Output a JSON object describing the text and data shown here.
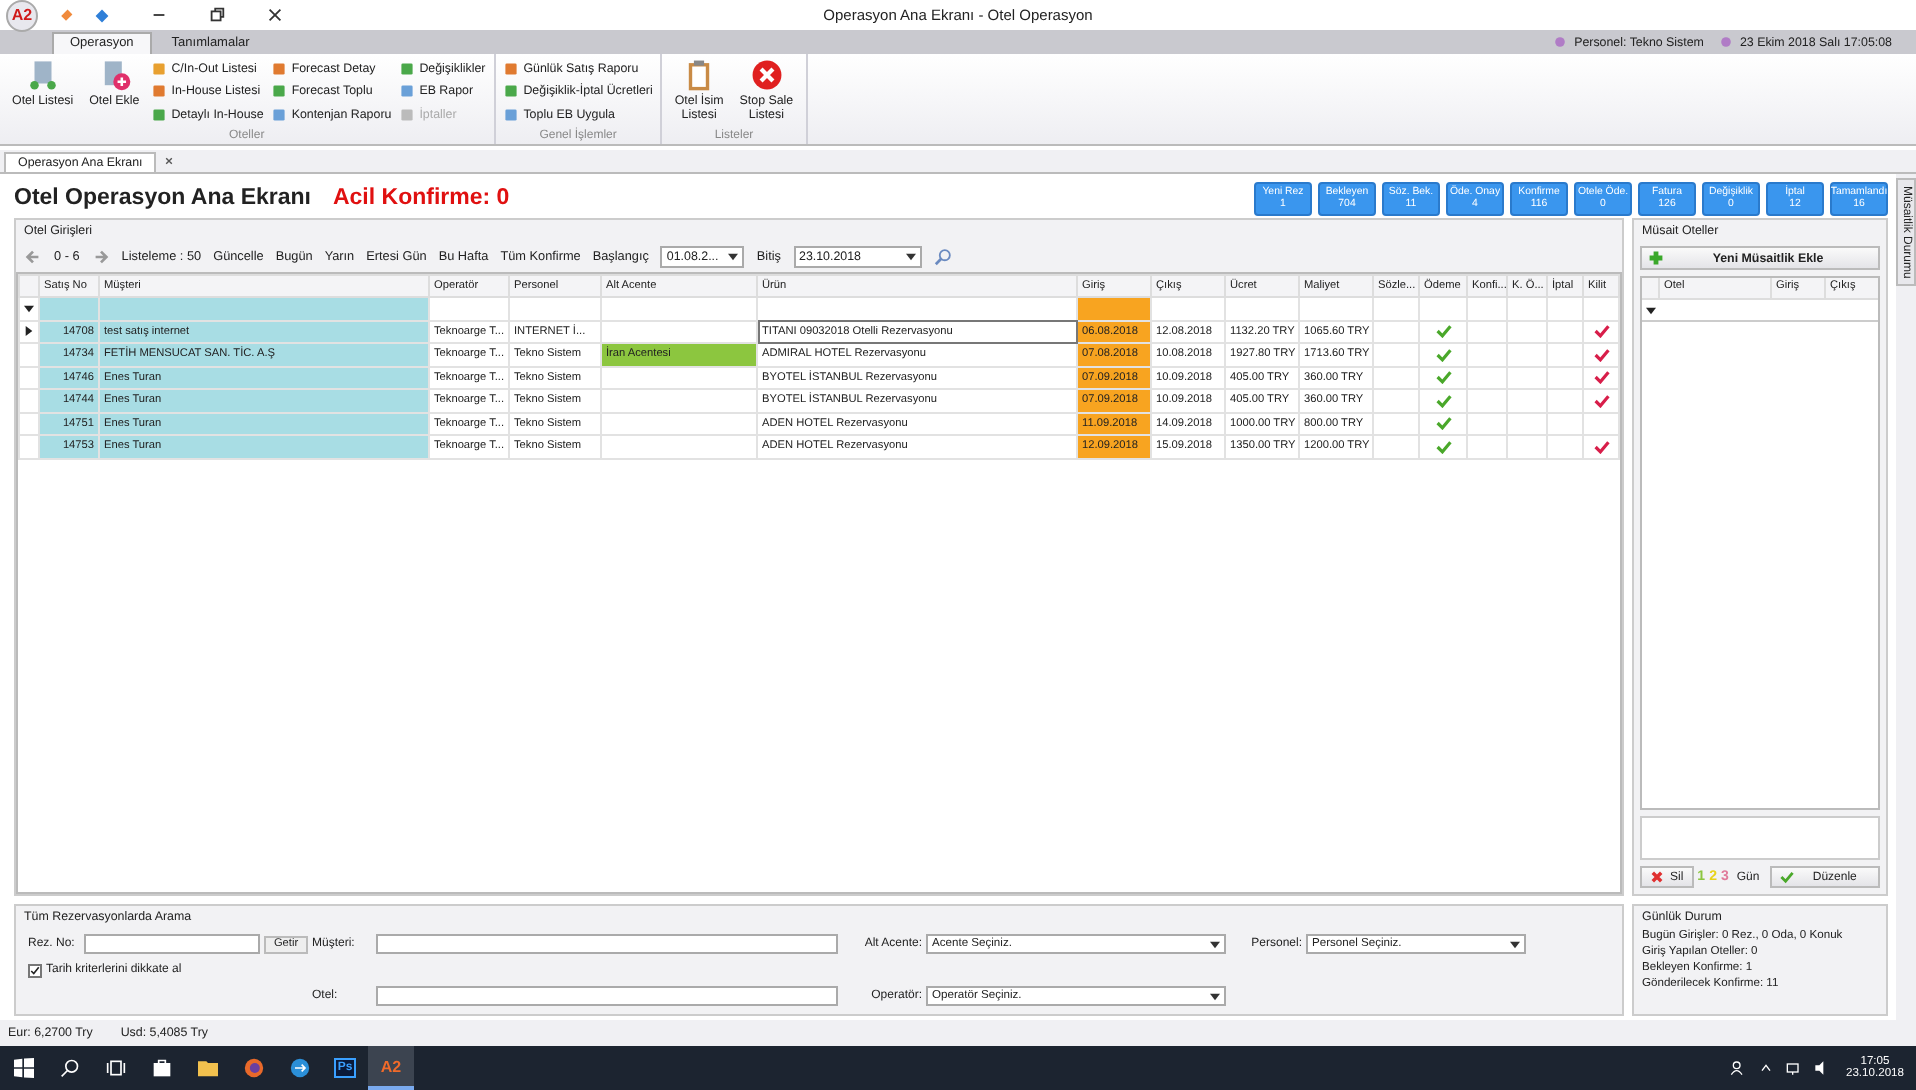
{
  "window": {
    "logo": "A2",
    "title": "Operasyon Ana Ekranı - Otel Operasyon"
  },
  "ribbon": {
    "tabs": [
      {
        "label": "Operasyon",
        "selected": true
      },
      {
        "label": "Tanımlamalar",
        "selected": false
      }
    ],
    "user": "Personel: Tekno Sistem",
    "datetime": "23 Ekim 2018 Salı 17:05:08",
    "groups": [
      {
        "label": "Oteller",
        "large": [
          {
            "kind": "hotel_list",
            "label": "Otel Listesi"
          },
          {
            "kind": "hotel_add",
            "label": "Otel Ekle"
          }
        ],
        "columns": [
          [
            {
              "label": "C/In-Out Listesi",
              "disabled": false
            },
            {
              "label": "In-House Listesi",
              "disabled": false
            },
            {
              "label": "Detaylı In-House",
              "disabled": false
            }
          ],
          [
            {
              "label": "Forecast Detay",
              "disabled": false
            },
            {
              "label": "Forecast Toplu",
              "disabled": false
            },
            {
              "label": "Kontenjan Raporu",
              "disabled": false
            }
          ],
          [
            {
              "label": "Değişiklikler",
              "disabled": false
            },
            {
              "label": "EB Rapor",
              "disabled": false
            },
            {
              "label": "İptaller",
              "disabled": true
            }
          ]
        ]
      },
      {
        "label": "Genel İşlemler",
        "columns": [
          [
            {
              "label": "Günlük Satış Raporu",
              "disabled": false
            },
            {
              "label": "Değişiklik-İptal Ücretleri",
              "disabled": false
            },
            {
              "label": "Toplu EB Uygula",
              "disabled": false
            }
          ]
        ]
      },
      {
        "label": "Listeler",
        "large": [
          {
            "kind": "clipboard",
            "label": "Otel İsim\nListesi"
          },
          {
            "kind": "stop",
            "label": "Stop Sale\nListesi"
          }
        ]
      }
    ]
  },
  "doc_tab": "Operasyon Ana Ekranı",
  "header": {
    "title": "Otel Operasyon Ana Ekranı",
    "alert": "Acil Konfirme: 0",
    "badges": [
      {
        "label": "Yeni Rez",
        "count": "1"
      },
      {
        "label": "Bekleyen",
        "count": "704"
      },
      {
        "label": "Söz. Bek.",
        "count": "11"
      },
      {
        "label": "Öde. Onay",
        "count": "4"
      },
      {
        "label": "Konfirme",
        "count": "116"
      },
      {
        "label": "Otele Öde.",
        "count": "0"
      },
      {
        "label": "Fatura",
        "count": "126"
      },
      {
        "label": "Değişiklik",
        "count": "0"
      },
      {
        "label": "İptal",
        "count": "12"
      },
      {
        "label": "Tamamlandı",
        "count": "16"
      }
    ]
  },
  "side_tab": "Müsaitlik Durumu",
  "entries": {
    "title": "Otel Girişleri",
    "pager": "0 - 6",
    "page_size": "Listeleme : 50",
    "buttons": [
      "Güncelle",
      "Bugün",
      "Yarın",
      "Ertesi Gün",
      "Bu Hafta",
      "Tüm Konfirme"
    ],
    "start_label": "Başlangıç",
    "start_value": "01.08.2...",
    "end_label": "Bitiş",
    "end_value": "23.10.2018",
    "columns": [
      "Satış No",
      "Müşteri",
      "Operatör",
      "Personel",
      "Alt Acente",
      "Ürün",
      "Giriş",
      "Çıkış",
      "Ücret",
      "Maliyet",
      "Sözle...",
      "Ödeme",
      "Konfi...",
      "K. Ö...",
      "İptal",
      "Kilit"
    ],
    "rows": [
      {
        "selected": true,
        "no": "14708",
        "customer": "test satış internet",
        "operator": "Teknoarge T...",
        "staff": "INTERNET İ...",
        "agency": "",
        "product": "TITANI 09032018 Otelli Rezervasyonu",
        "checkin": "06.08.2018",
        "checkout": "12.08.2018",
        "price": "1132.20 TRY",
        "cost": "1065.60 TRY",
        "paid": true,
        "locked": true
      },
      {
        "selected": false,
        "no": "14734",
        "customer": "FETİH MENSUCAT SAN. TİC. A.Ş",
        "operator": "Teknoarge T...",
        "staff": "Tekno Sistem",
        "agency": "İran Acentesi",
        "product": "ADMIRAL HOTEL Rezervasyonu",
        "checkin": "07.08.2018",
        "checkout": "10.08.2018",
        "price": "1927.80 TRY",
        "cost": "1713.60 TRY",
        "paid": true,
        "locked": true
      },
      {
        "selected": false,
        "no": "14746",
        "customer": "Enes Turan",
        "operator": "Teknoarge T...",
        "staff": "Tekno Sistem",
        "agency": "",
        "product": "BYOTEL İSTANBUL Rezervasyonu",
        "checkin": "07.09.2018",
        "checkout": "10.09.2018",
        "price": "405.00 TRY",
        "cost": "360.00 TRY",
        "paid": true,
        "locked": true
      },
      {
        "selected": false,
        "no": "14744",
        "customer": "Enes Turan",
        "operator": "Teknoarge T...",
        "staff": "Tekno Sistem",
        "agency": "",
        "product": "BYOTEL İSTANBUL Rezervasyonu",
        "checkin": "07.09.2018",
        "checkout": "10.09.2018",
        "price": "405.00 TRY",
        "cost": "360.00 TRY",
        "paid": true,
        "locked": true
      },
      {
        "selected": false,
        "no": "14751",
        "customer": "Enes Turan",
        "operator": "Teknoarge T...",
        "staff": "Tekno Sistem",
        "agency": "",
        "product": "ADEN HOTEL Rezervasyonu",
        "checkin": "11.09.2018",
        "checkout": "14.09.2018",
        "price": "1000.00 TRY",
        "cost": "800.00 TRY",
        "paid": true,
        "locked": false
      },
      {
        "selected": false,
        "no": "14753",
        "customer": "Enes Turan",
        "operator": "Teknoarge T...",
        "staff": "Tekno Sistem",
        "agency": "",
        "product": "ADEN HOTEL Rezervasyonu",
        "checkin": "12.09.2018",
        "checkout": "15.09.2018",
        "price": "1350.00 TRY",
        "cost": "1200.00 TRY",
        "paid": true,
        "locked": true
      }
    ]
  },
  "available": {
    "title": "Müsait Oteller",
    "add_button": "Yeni Müsaitlik Ekle",
    "columns": [
      "Otel",
      "Giriş",
      "Çıkış"
    ],
    "delete_button": "Sil",
    "days": [
      {
        "label": "1",
        "color": "#8cc63f"
      },
      {
        "label": "2",
        "color": "#e8d31a"
      },
      {
        "label": "3",
        "color": "#e07a9a"
      }
    ],
    "days_label": "Gün",
    "edit_button": "Düzenle"
  },
  "search": {
    "title": "Tüm Rezervasyonlarda Arama",
    "rez_no_label": "Rez. No:",
    "fetch_button": "Getir",
    "customer_label": "Müşteri:",
    "agency_label": "Alt Acente:",
    "agency_value": "Acente Seçiniz.",
    "staff_label": "Personel:",
    "staff_value": "Personel Seçiniz.",
    "date_filter": {
      "label": "Tarih kriterlerini dikkate al",
      "checked": true
    },
    "hotel_label": "Otel:",
    "operator_label": "Operatör:",
    "operator_value": "Operatör Seçiniz."
  },
  "daily": {
    "title": "Günlük Durum",
    "lines": [
      "Bugün Girişler:  0 Rez., 0 Oda, 0 Konuk",
      "Giriş Yapılan Oteller:  0",
      "Bekleyen Konfirme:  1",
      "Gönderilecek Konfirme:  11"
    ]
  },
  "status_bar": [
    "Eur: 6,2700 Try",
    "Usd: 5,4085 Try"
  ],
  "taskbar": {
    "apps": [
      {
        "kind": "start",
        "selected": false
      },
      {
        "kind": "search",
        "selected": false
      },
      {
        "kind": "task_view",
        "selected": false
      },
      {
        "kind": "store",
        "selected": false
      },
      {
        "kind": "folder",
        "selected": false
      },
      {
        "kind": "browser",
        "selected": false
      },
      {
        "kind": "remote",
        "selected": false
      },
      {
        "kind": "ps",
        "label": "Ps",
        "selected": false
      },
      {
        "kind": "a2",
        "label": "A2",
        "selected": true
      }
    ],
    "time": "17:05",
    "date": "23.10.2018"
  }
}
